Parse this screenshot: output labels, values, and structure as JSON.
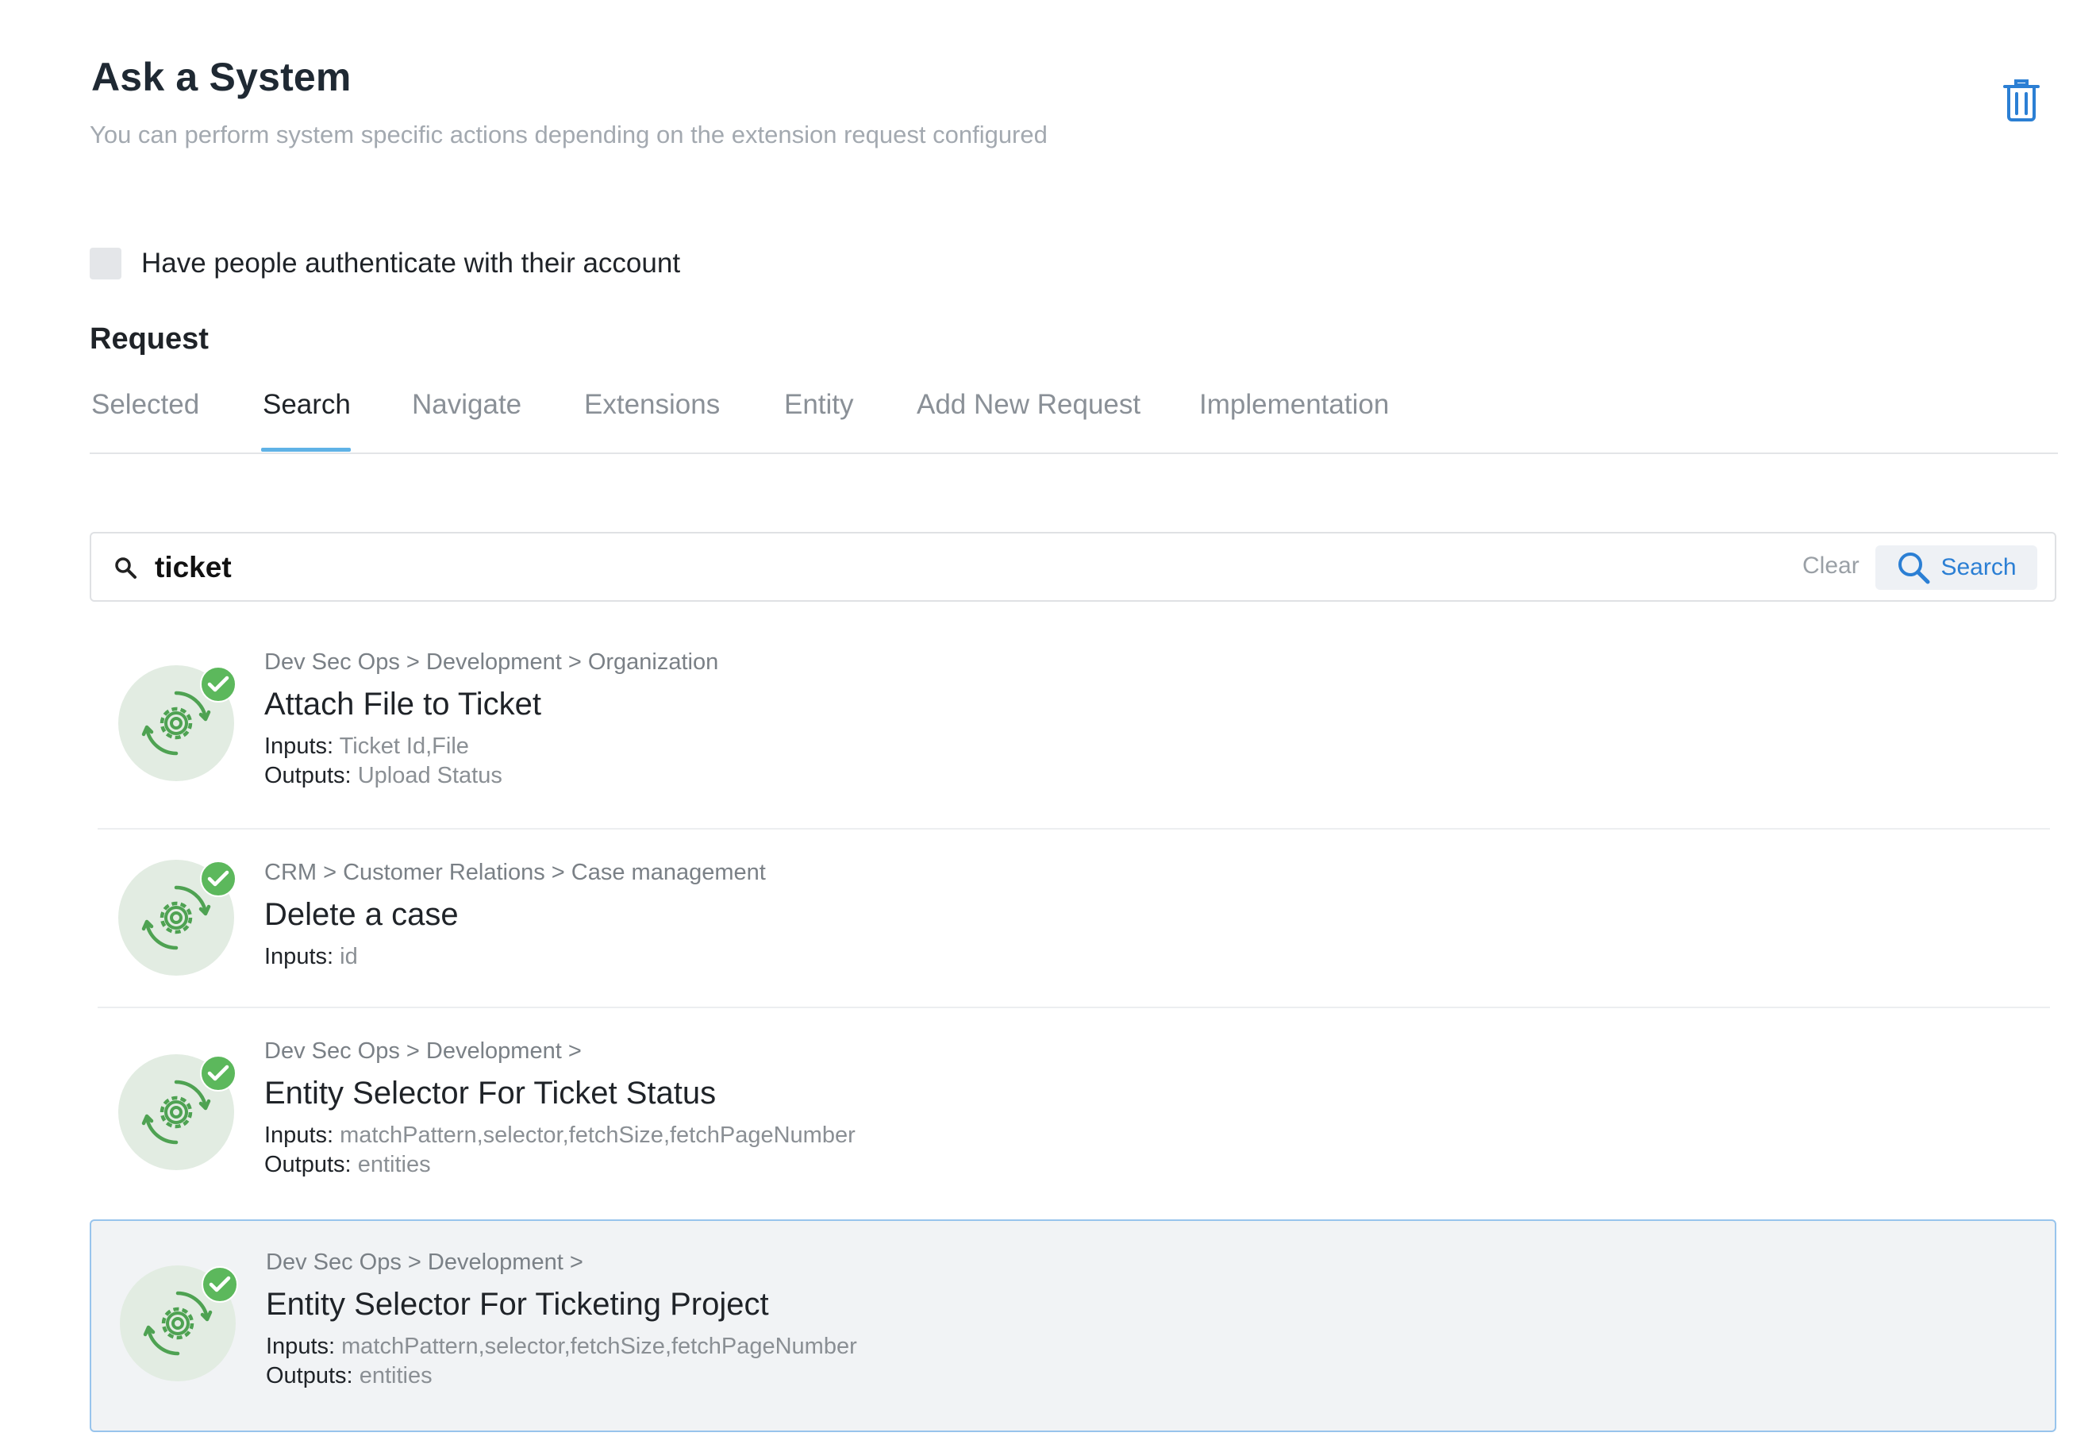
{
  "header": {
    "title": "Ask a System",
    "subtitle": "You can perform system specific actions depending on the extension request configured",
    "delete_icon": "trash-icon"
  },
  "auth": {
    "label": "Have people authenticate with their account",
    "checked": false
  },
  "request": {
    "section_title": "Request",
    "tabs": [
      {
        "label": "Selected"
      },
      {
        "label": "Search"
      },
      {
        "label": "Navigate"
      },
      {
        "label": "Extensions"
      },
      {
        "label": "Entity"
      },
      {
        "label": "Add New Request"
      },
      {
        "label": "Implementation"
      }
    ],
    "active_tab": "Search"
  },
  "search": {
    "value": "ticket",
    "clear_label": "Clear",
    "button_label": "Search",
    "icon": "search-icon"
  },
  "results": [
    {
      "breadcrumb": "Dev Sec Ops > Development > Organization",
      "title": "Attach File to Ticket",
      "inputs_label": "Inputs:",
      "inputs": "Ticket Id,File",
      "outputs_label": "Outputs:",
      "outputs": "Upload Status"
    },
    {
      "breadcrumb": "CRM > Customer Relations > Case management",
      "title": "Delete a case",
      "inputs_label": "Inputs:",
      "inputs": "id"
    },
    {
      "breadcrumb": "Dev Sec Ops > Development >",
      "title": "Entity Selector For Ticket Status",
      "inputs_label": "Inputs:",
      "inputs": "matchPattern,selector,fetchSize,fetchPageNumber",
      "outputs_label": "Outputs:",
      "outputs": "entities"
    },
    {
      "breadcrumb": "Dev Sec Ops > Development >",
      "title": "Entity Selector For Ticketing Project",
      "inputs_label": "Inputs:",
      "inputs": "matchPattern,selector,fetchSize,fetchPageNumber",
      "outputs_label": "Outputs:",
      "outputs": "entities",
      "selected": true
    }
  ],
  "colors": {
    "accent": "#2b7fd4",
    "tab_underline": "#5fb2e6",
    "check_green": "#5cb85c",
    "gear_green": "#4ea252"
  }
}
